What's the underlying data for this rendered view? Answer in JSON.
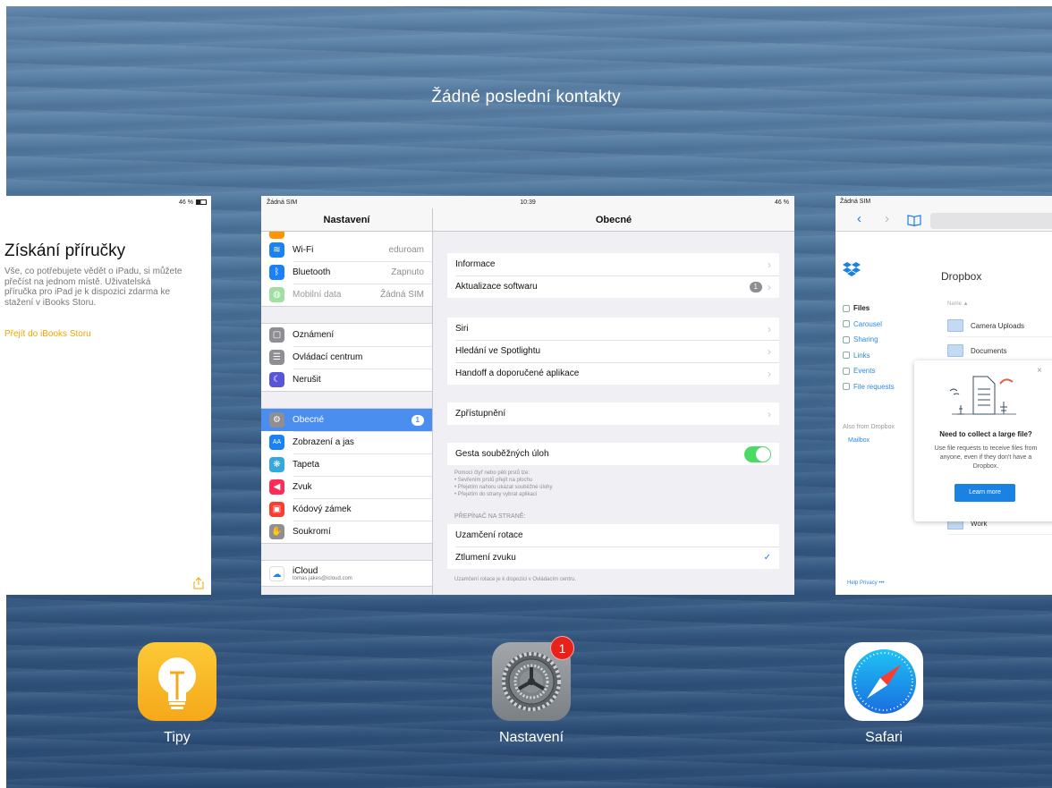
{
  "header": {
    "title": "Žádné poslední kontakty"
  },
  "tips_card": {
    "status_right": "46 %",
    "title": "Získání příručky",
    "body": "Vše, co potřebujete vědět o iPadu, si můžete přečíst na jednom místě. Uživatelská příručka pro iPad je k dispozici zdarma ke stažení v iBooks Storu.",
    "link": "Přejít do iBooks Storu"
  },
  "settings_card": {
    "status_left": "Žádná SIM",
    "status_time": "10:39",
    "status_right": "46 %",
    "sidebar_title": "Nastavení",
    "sidebar_groups": [
      [
        {
          "label": "Wi-Fi",
          "value": "eduroam",
          "icon_color": "#1a82f5",
          "glyph": "≋"
        },
        {
          "label": "Bluetooth",
          "value": "Zapnuto",
          "icon_color": "#1a82f5",
          "glyph": "ᛒ"
        },
        {
          "label": "Mobilní data",
          "value": "Žádná SIM",
          "icon_color": "#7bd27b",
          "glyph": "◍"
        }
      ],
      [
        {
          "label": "Oznámení",
          "icon_color": "#8e8e93",
          "glyph": "▢"
        },
        {
          "label": "Ovládací centrum",
          "icon_color": "#8e8e93",
          "glyph": "☰"
        },
        {
          "label": "Nerušit",
          "icon_color": "#5856d6",
          "glyph": "☾"
        }
      ],
      [
        {
          "label": "Obecné",
          "badge": "1",
          "icon_color": "#8e8e93",
          "glyph": "⚙"
        },
        {
          "label": "Zobrazení a jas",
          "icon_color": "#1a82f5",
          "glyph": "AA"
        },
        {
          "label": "Tapeta",
          "icon_color": "#34aadc",
          "glyph": "❋"
        },
        {
          "label": "Zvuk",
          "icon_color": "#ff2d55",
          "glyph": "◀"
        },
        {
          "label": "Kódový zámek",
          "icon_color": "#ff3b30",
          "glyph": "▣"
        },
        {
          "label": "Soukromí",
          "icon_color": "#8e8e93",
          "glyph": "✋"
        }
      ],
      [
        {
          "label": "iCloud",
          "sub": "tomas.jakes@icloud.com",
          "icon_color": "#ffffff",
          "glyph": "☁"
        }
      ]
    ],
    "detail_title": "Obecné",
    "detail_groups": [
      [
        {
          "label": "Informace"
        },
        {
          "label": "Aktualizace softwaru",
          "count": "1"
        }
      ],
      [
        {
          "label": "Siri"
        },
        {
          "label": "Hledání ve Spotlightu"
        },
        {
          "label": "Handoff a doporučené aplikace"
        }
      ],
      [
        {
          "label": "Zpřístupnění"
        }
      ],
      [
        {
          "label": "Gesta souběžných úloh",
          "toggle": true
        }
      ],
      [
        {
          "label": "Uzamčení rotace"
        },
        {
          "label": "Ztlumení zvuku",
          "checked": true
        }
      ]
    ],
    "gesture_note": "Pomocí čtyř nebo pěti prstů lze:\n• Sevřením prstů přejít na plochu\n• Přejetím nahoru ukázat souběžné úlohy\n• Přejetím do strany vybrat aplikaci",
    "side_switch_header": "PŘEPÍNAČ NA STRANĚ:",
    "rotation_note": "Uzamčení rotace je k dispozici v Ovládacím centru."
  },
  "safari_card": {
    "status_left": "Žádná SIM",
    "page_title": "Dropbox",
    "nav_items": [
      "Files",
      "Carousel",
      "Sharing",
      "Links",
      "Events",
      "File requests"
    ],
    "also_from": "Also from Dropbox",
    "mailbox": "Mailbox",
    "name_header": "Name ▲",
    "files": [
      "Camera Uploads",
      "Documents",
      "Work"
    ],
    "footer": "Help   Privacy   •••",
    "popup": {
      "title": "Need to collect a large file?",
      "body": "Use file requests to receive files from anyone, even if they don't have a Dropbox.",
      "button": "Learn more"
    }
  },
  "dock": [
    {
      "label": "Tipy"
    },
    {
      "label": "Nastavení",
      "badge": "1"
    },
    {
      "label": "Safari"
    }
  ]
}
